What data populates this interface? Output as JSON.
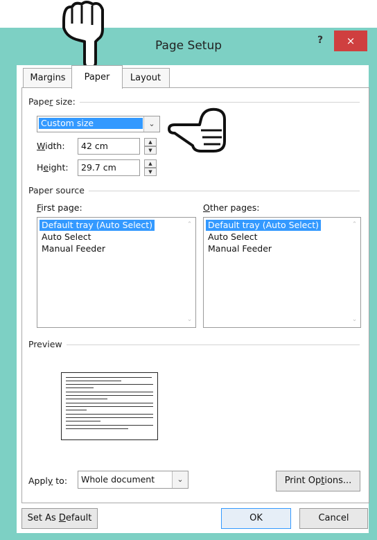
{
  "window": {
    "title": "Page Setup",
    "help_label": "?",
    "close_label": "×"
  },
  "tabs": [
    {
      "label": "Margins"
    },
    {
      "label": "Paper"
    },
    {
      "label": "Layout"
    }
  ],
  "paper_size": {
    "group_label_pre": "Pape",
    "group_label_key": "r",
    "group_label_post": " size:",
    "combo_value": "Custom size",
    "width_label_key": "W",
    "width_label_rest": "idth:",
    "width_value": "42 cm",
    "height_label_pre": "H",
    "height_label_key": "e",
    "height_label_rest": "ight:",
    "height_value": "29.7 cm"
  },
  "paper_source": {
    "group_label": "Paper source",
    "first_page_label_key": "F",
    "first_page_label_rest": "irst page:",
    "other_pages_label_key": "O",
    "other_pages_label_rest": "ther pages:",
    "first_page_items": [
      "Default tray (Auto Select)",
      "Auto Select",
      "Manual Feeder"
    ],
    "other_pages_items": [
      "Default tray (Auto Select)",
      "Auto Select",
      "Manual Feeder"
    ],
    "selected_index": 0
  },
  "preview": {
    "group_label": "Preview"
  },
  "apply_to": {
    "label_pre": "Appl",
    "label_key": "y",
    "label_post": " to:",
    "value": "Whole document"
  },
  "buttons": {
    "print_options_pre": "Print Op",
    "print_options_key": "t",
    "print_options_post": "ions...",
    "set_default_pre": "Set As ",
    "set_default_key": "D",
    "set_default_post": "efault",
    "ok": "OK",
    "cancel": "Cancel"
  },
  "icons": {
    "pointer_hand_top": "hand-pointing-down-icon",
    "pointer_hand_right": "hand-pointing-left-icon"
  },
  "colors": {
    "window_frame": "#7dd0c4",
    "close_button": "#cf3f3f",
    "selection": "#3399ff"
  }
}
